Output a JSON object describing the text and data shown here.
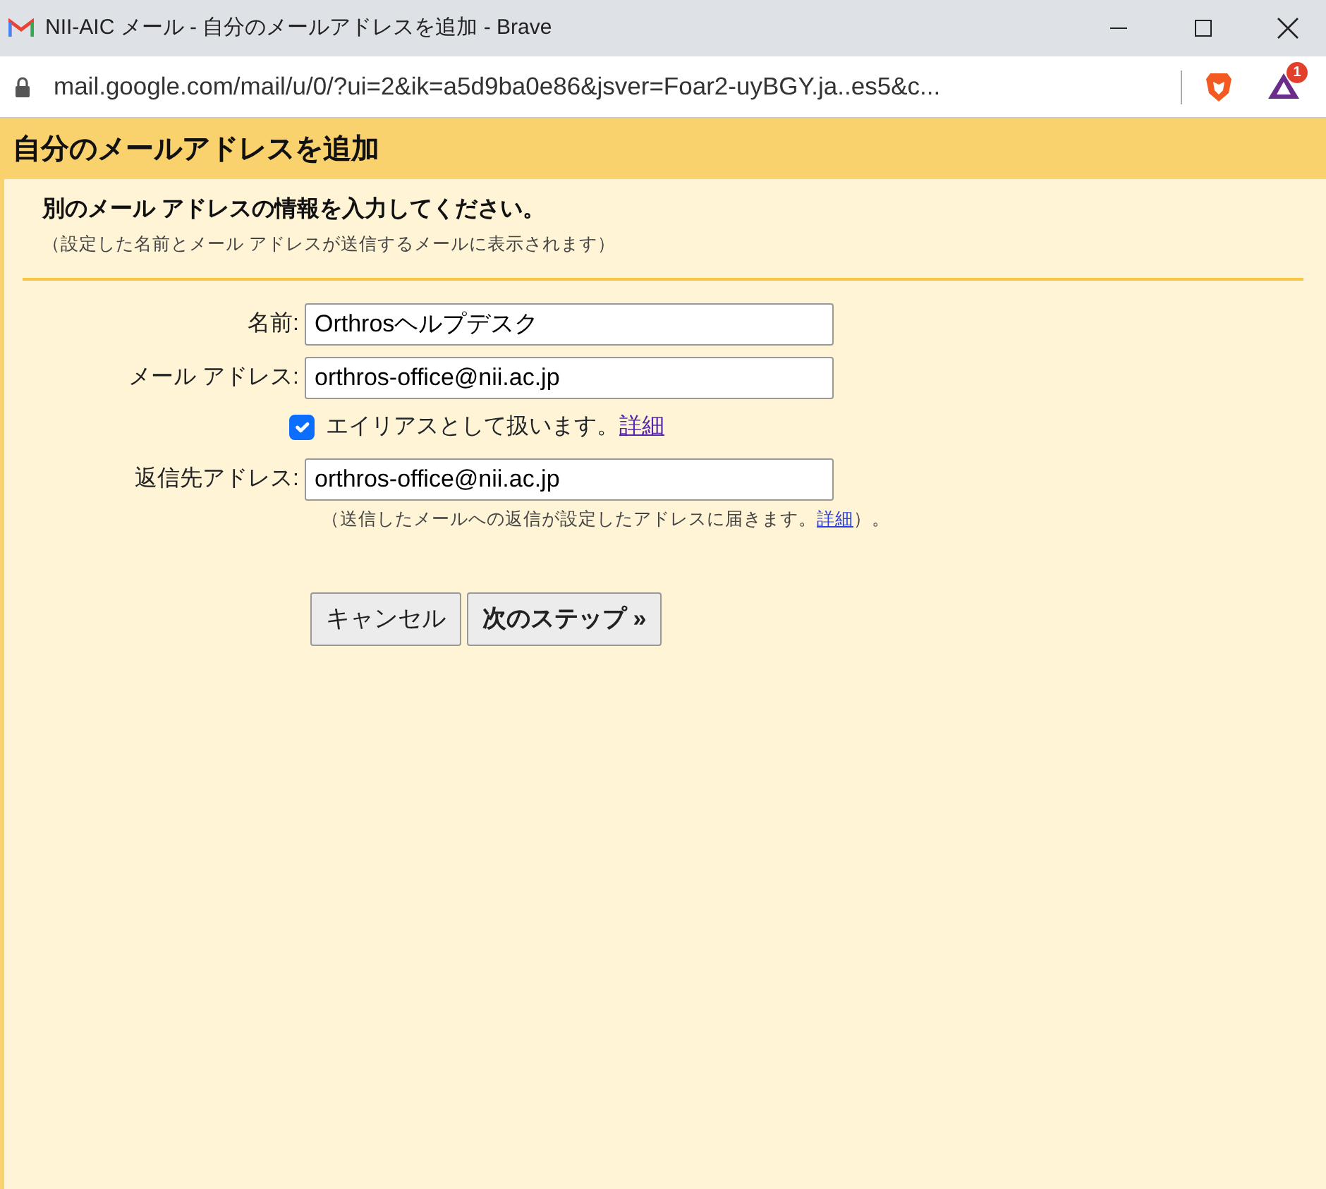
{
  "window": {
    "title": "NII-AIC メール - 自分のメールアドレスを追加 - Brave",
    "url": "mail.google.com/mail/u/0/?ui=2&ik=a5d9ba0e86&jsver=Foar2-uyBGY.ja..es5&c...",
    "rewards_badge": "1"
  },
  "dialog": {
    "title": "自分のメールアドレスを追加",
    "heading": "別のメール アドレスの情報を入力してください。",
    "subheading": "（設定した名前とメール アドレスが送信するメールに表示されます）",
    "fields": [
      {
        "kind": "text",
        "label": "名前:",
        "value": "Orthrosヘルプデスク"
      },
      {
        "kind": "text",
        "label": "メール アドレス:",
        "value": "orthros-office@nii.ac.jp"
      },
      {
        "kind": "checkbox",
        "label": "エイリアスとして扱います。",
        "link": "詳細",
        "checked": true
      },
      {
        "kind": "text",
        "label": "返信先アドレス:",
        "value": "orthros-office@nii.ac.jp",
        "hint_before": "（送信したメールへの返信が設定したアドレスに届きます。",
        "hint_link": "詳細",
        "hint_after": "）。"
      }
    ],
    "buttons": [
      {
        "label": "キャンセル",
        "primary": false
      },
      {
        "label": "次のステップ »",
        "primary": true
      }
    ]
  }
}
